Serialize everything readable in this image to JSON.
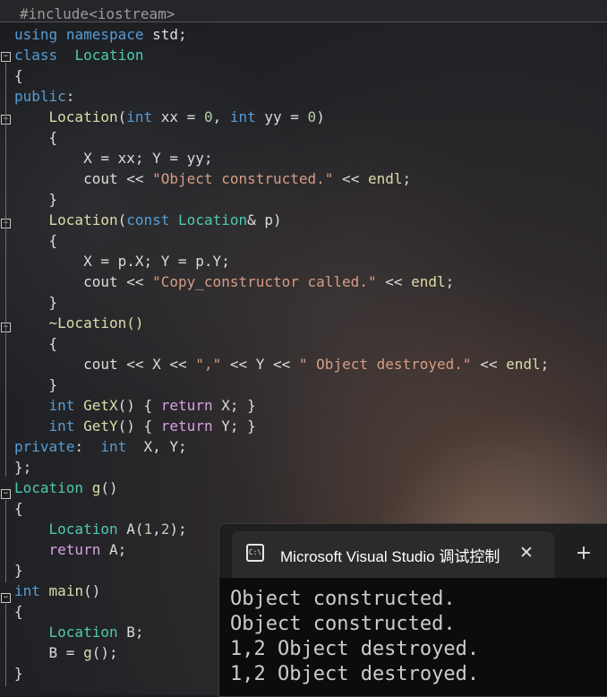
{
  "editor": {
    "lines": [
      "#include<iostream>",
      "using namespace std;",
      "class  Location",
      "{",
      "public:",
      "    Location(int xx = 0, int yy = 0)",
      "    {",
      "        X = xx; Y = yy;",
      "        cout << \"Object constructed.\" << endl;",
      "    }",
      "    Location(const Location& p)",
      "    {",
      "        X = p.X; Y = p.Y;",
      "        cout << \"Copy_constructor called.\" << endl;",
      "    }",
      "    ~Location()",
      "    {",
      "        cout << X << \",\" << Y << \" Object destroyed.\" << endl;",
      "    }",
      "    int GetX() { return X; }",
      "    int GetY() { return Y; }",
      "private:  int  X, Y;",
      "};",
      "Location g()",
      "{",
      "    Location A(1,2);",
      "    return A;",
      "}",
      "int main()",
      "{",
      "    Location B;",
      "    B = g();",
      "}"
    ]
  },
  "console": {
    "title": "Microsoft Visual Studio 调试控制台",
    "icon": "terminal-icon",
    "close_symbol": "✕",
    "new_tab_symbol": "+",
    "output": [
      "Object constructed.",
      "Object constructed.",
      "1,2 Object destroyed.",
      "1,2 Object destroyed."
    ]
  },
  "colors": {
    "keyword": "#569cd6",
    "control_keyword": "#d8a0df",
    "type": "#4ec9b0",
    "function": "#dcdcaa",
    "string": "#d69d85",
    "number": "#b5cea8",
    "console_bg": "#0c0c0c"
  }
}
